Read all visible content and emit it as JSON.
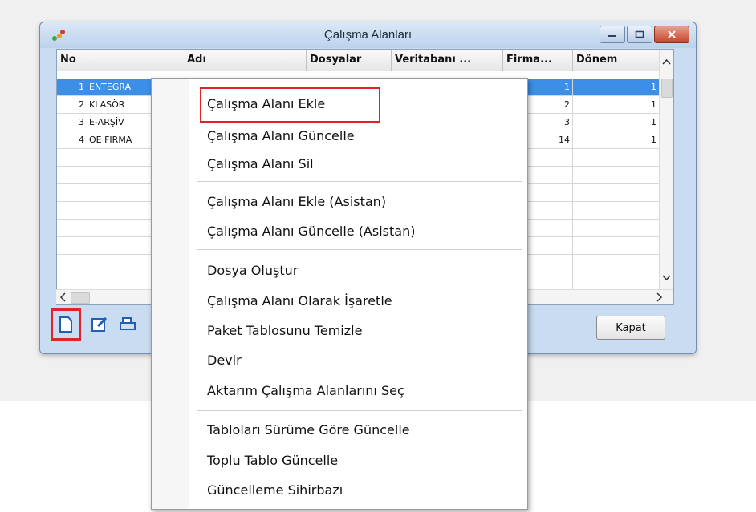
{
  "window": {
    "title": "Çalışma Alanları"
  },
  "table": {
    "columns": [
      "No",
      "Adı",
      "Dosyalar",
      "Veritabanı ...",
      "Firma...",
      "Dönem"
    ],
    "rows": [
      {
        "no": "1",
        "name": "ENTEGRA",
        "firma": "1",
        "donem": "1",
        "selected": true
      },
      {
        "no": "2",
        "name": "KLASÖR",
        "firma": "2",
        "donem": "1",
        "selected": false
      },
      {
        "no": "3",
        "name": "E-ARŞİV",
        "firma": "3",
        "donem": "1",
        "selected": false
      },
      {
        "no": "4",
        "name": "ÖE FIRMA",
        "firma": "14",
        "donem": "1",
        "selected": false
      }
    ]
  },
  "toolbar": {
    "close_label": "Kapat"
  },
  "menu": {
    "items": [
      "Çalışma Alanı Ekle",
      "Çalışma Alanı Güncelle",
      "Çalışma Alanı Sil",
      "Çalışma Alanı Ekle (Asistan)",
      "Çalışma Alanı Güncelle (Asistan)",
      "Dosya Oluştur",
      "Çalışma Alanı Olarak İşaretle",
      "Paket Tablosunu Temizle",
      "Devir",
      "Aktarım Çalışma Alanlarını Seç",
      "Tabloları Sürüme Göre Güncelle",
      "Toplu Tablo Güncelle",
      "Güncelleme Sihirbazı"
    ]
  },
  "colors": {
    "highlight": "#e0232b",
    "selection": "#3d8ee6"
  }
}
